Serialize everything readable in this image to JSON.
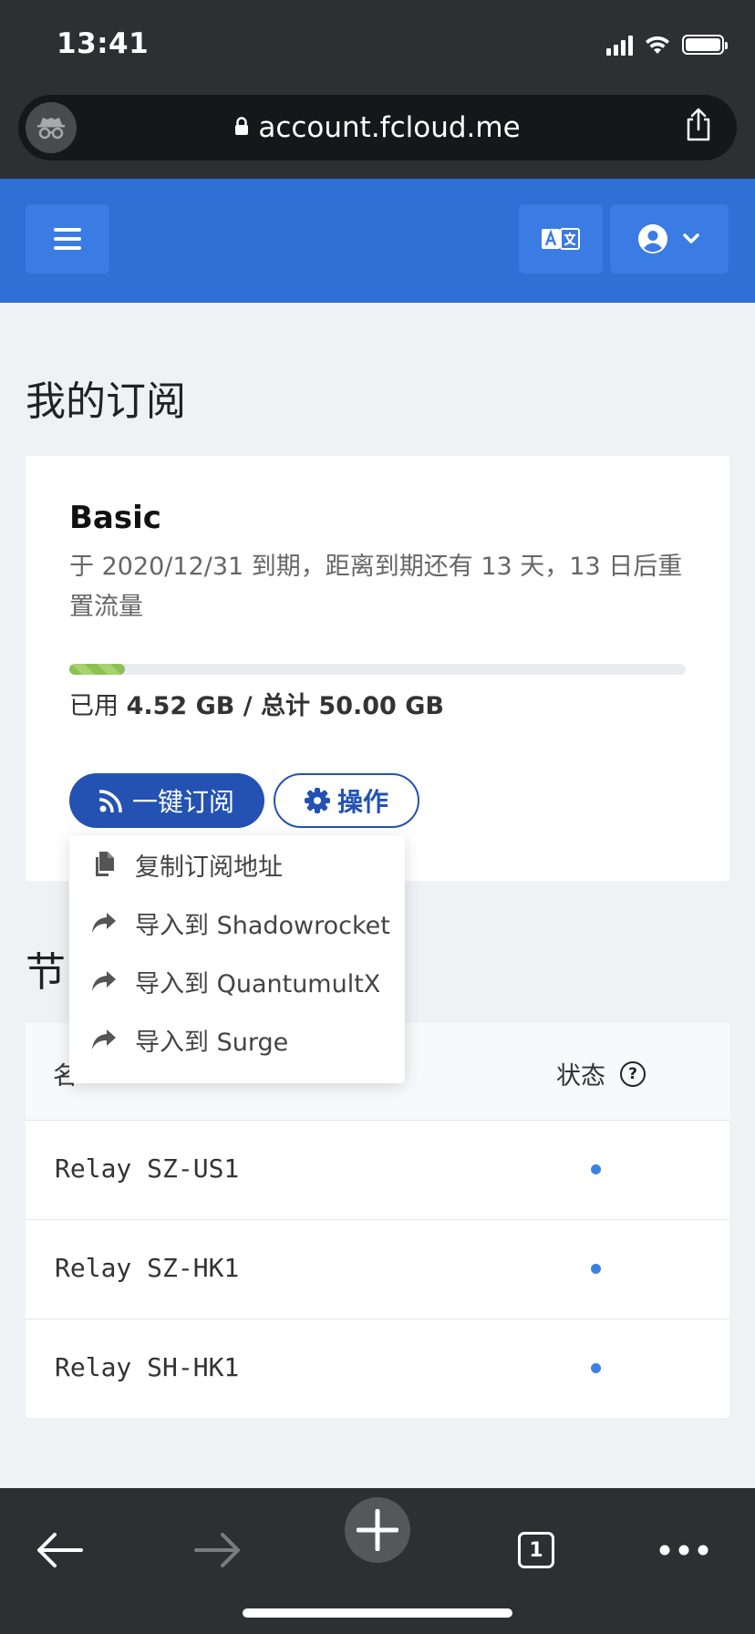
{
  "status_bar": {
    "time": "13:41"
  },
  "browser": {
    "url": "account.fcloud.me",
    "tab_count": "1"
  },
  "navbar": {},
  "page": {
    "title": "我的订阅",
    "plan": {
      "name": "Basic",
      "description": "于 2020/12/31 到期，距离到期还有 13 天，13 日后重置流量",
      "usage_prefix": "已用 ",
      "used": "4.52 GB",
      "usage_sep": " / 总计 ",
      "total": "50.00 GB",
      "usage_fraction": 0.0904
    },
    "subscribe_button": "一键订阅",
    "ops_button": "操作",
    "dropdown": [
      {
        "label": "复制订阅地址",
        "icon": "copy-icon"
      },
      {
        "label": "导入到 Shadowrocket",
        "icon": "share-arrow-icon"
      },
      {
        "label": "导入到 QuantumultX",
        "icon": "share-arrow-icon"
      },
      {
        "label": "导入到 Surge",
        "icon": "share-arrow-icon"
      }
    ],
    "nodes_section_title": "节",
    "table": {
      "col_name": "名",
      "col_status": "状态",
      "help_glyph": "?",
      "rows": [
        {
          "name": "Relay SZ-US1",
          "status_color": "#3b82e0"
        },
        {
          "name": "Relay SZ-HK1",
          "status_color": "#3b82e0"
        },
        {
          "name": "Relay SH-HK1",
          "status_color": "#3b82e0"
        }
      ]
    }
  },
  "colors": {
    "navbar": "#2f6fd6",
    "primary": "#2352b3",
    "progress": "#8cc152",
    "chrome": "#2e2f33"
  }
}
